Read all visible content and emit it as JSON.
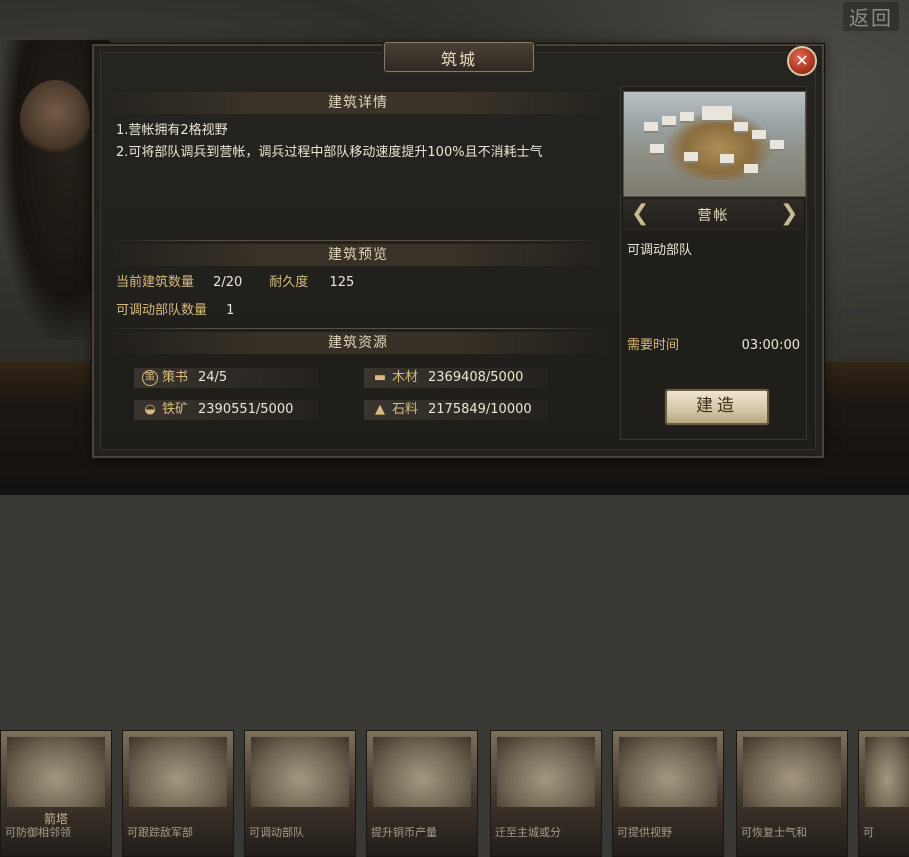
{
  "top_right": {
    "return_label": "返回"
  },
  "dialog": {
    "title": "筑城",
    "close_glyph": "✕",
    "details": {
      "header": "建筑详情",
      "lines": [
        "1.营帐拥有2格视野",
        "2.可将部队调兵到营帐，调兵过程中部队移动速度提升100%且不消耗士气"
      ]
    },
    "preview": {
      "header": "建筑预览",
      "count_label": "当前建筑数量",
      "count_value": "2/20",
      "durability_label": "耐久度",
      "durability_value": "125",
      "troops_label": "可调动部队数量",
      "troops_value": "1"
    },
    "resources": {
      "header": "建筑资源",
      "items": [
        {
          "icon": "strategy-book-icon",
          "label": "策书",
          "value": "24/5"
        },
        {
          "icon": "wood-icon",
          "label": "木材",
          "value": "2369408/5000"
        },
        {
          "icon": "iron-ore-icon",
          "label": "铁矿",
          "value": "2390551/5000"
        },
        {
          "icon": "stone-icon",
          "label": "石料",
          "value": "2175849/10000"
        }
      ]
    },
    "building": {
      "name": "营帐",
      "description": "可调动部队",
      "time_label": "需要时间",
      "time_value": "03:00:00",
      "build_button": "建造"
    }
  },
  "bottom_cards": [
    {
      "title": "箭塔",
      "desc": "可防御相邻领"
    },
    {
      "title": "",
      "desc": "可跟踪敌军部"
    },
    {
      "title": "",
      "desc": "可调动部队"
    },
    {
      "title": "",
      "desc": "提升铜币产量"
    },
    {
      "title": "",
      "desc": "迁至主城或分"
    },
    {
      "title": "",
      "desc": "可提供视野"
    },
    {
      "title": "",
      "desc": "可恢复士气和"
    },
    {
      "title": "",
      "desc": "可"
    }
  ]
}
